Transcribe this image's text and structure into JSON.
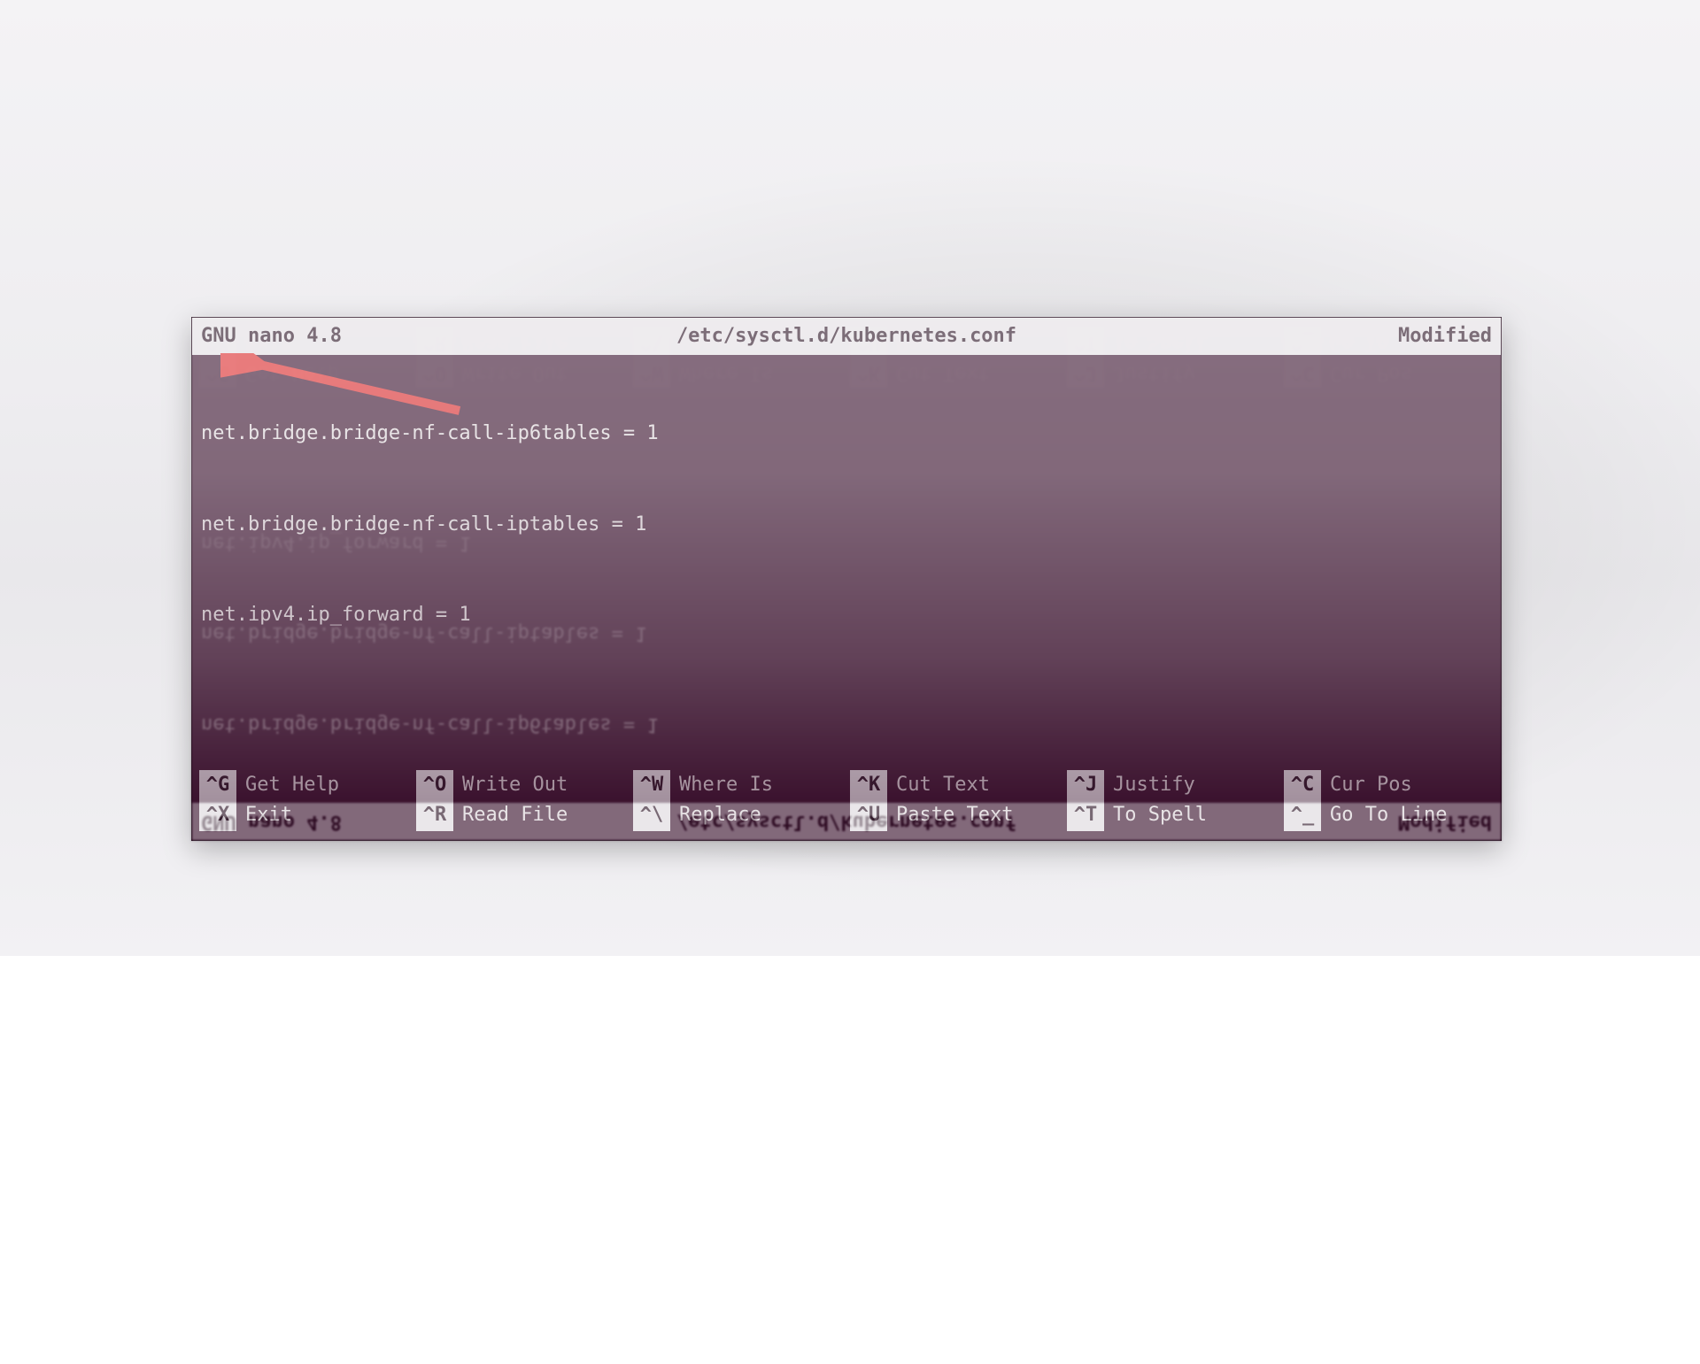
{
  "title": {
    "left": "  GNU nano 4.8",
    "center": "/etc/sysctl.d/kubernetes.conf",
    "right": "Modified"
  },
  "lines": [
    "net.bridge.bridge-nf-call-ip6tables = 1",
    "net.bridge.bridge-nf-call-iptables = 1",
    "net.ipv4.ip_forward = 1"
  ],
  "shortcuts_row1": [
    {
      "key": "^G",
      "label": "Get Help"
    },
    {
      "key": "^O",
      "label": "Write Out"
    },
    {
      "key": "^W",
      "label": "Where Is"
    },
    {
      "key": "^K",
      "label": "Cut Text"
    },
    {
      "key": "^J",
      "label": "Justify"
    },
    {
      "key": "^C",
      "label": "Cur Pos"
    }
  ],
  "shortcuts_row2": [
    {
      "key": "^X",
      "label": "Exit"
    },
    {
      "key": "^R",
      "label": "Read File"
    },
    {
      "key": "^\\",
      "label": "Replace"
    },
    {
      "key": "^U",
      "label": "Paste Text"
    },
    {
      "key": "^T",
      "label": "To Spell"
    },
    {
      "key": "^_",
      "label": "Go To Line"
    }
  ]
}
